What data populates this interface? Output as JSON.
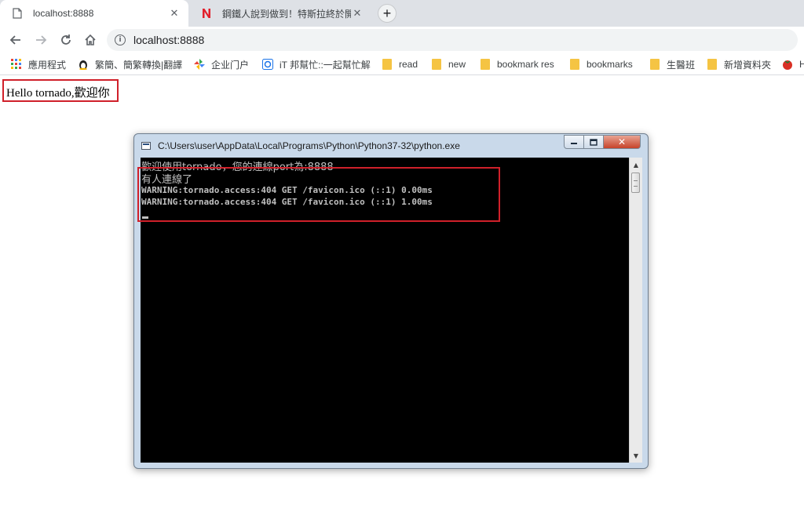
{
  "browser": {
    "tabs": [
      {
        "title": "localhost:8888",
        "favicon": "page-icon",
        "active": true
      },
      {
        "title": "鋼鐵人說到做到！特斯拉終於開放",
        "favicon": "n-logo-icon",
        "active": false
      }
    ],
    "address_bar": {
      "url": "localhost:8888",
      "icon": "info-icon"
    },
    "bookmarks": [
      {
        "label": "應用程式",
        "icon": "apps-grid-icon"
      },
      {
        "label": "繁簡、簡繁轉換|翻譯",
        "icon": "penguin-icon"
      },
      {
        "label": "企业门户",
        "icon": "pinwheel-icon"
      },
      {
        "label": "iT 邦幫忙::一起幫忙解",
        "icon": "ithome-icon"
      },
      {
        "label": "read",
        "icon": "folder-icon"
      },
      {
        "label": "new",
        "icon": "folder-icon"
      },
      {
        "label": "bookmark res",
        "icon": "folder-icon"
      },
      {
        "label": "bookmarks",
        "icon": "folder-icon"
      },
      {
        "label": "生醫班",
        "icon": "folder-icon"
      },
      {
        "label": "新增資料夾",
        "icon": "folder-icon"
      },
      {
        "label": "H",
        "icon": "tomato-icon"
      }
    ]
  },
  "page": {
    "text": "Hello tornado,歡迎你"
  },
  "console": {
    "title": "C:\\Users\\user\\AppData\\Local\\Programs\\Python\\Python37-32\\python.exe",
    "lines": [
      "歡迎使用tornado，您的連線port為:8888",
      "有人連線了",
      "WARNING:tornado.access:404 GET /favicon.ico (::1) 0.00ms",
      "WARNING:tornado.access:404 GET /favicon.ico (::1) 1.00ms"
    ],
    "buttons": {
      "minimize": "minimize-icon",
      "maximize": "maximize-icon",
      "close": "close-icon"
    }
  },
  "colors": {
    "annotation": "#d0202a",
    "console_bg": "#000000",
    "console_text": "#c0c0c0",
    "tabstrip": "#dee1e6"
  }
}
